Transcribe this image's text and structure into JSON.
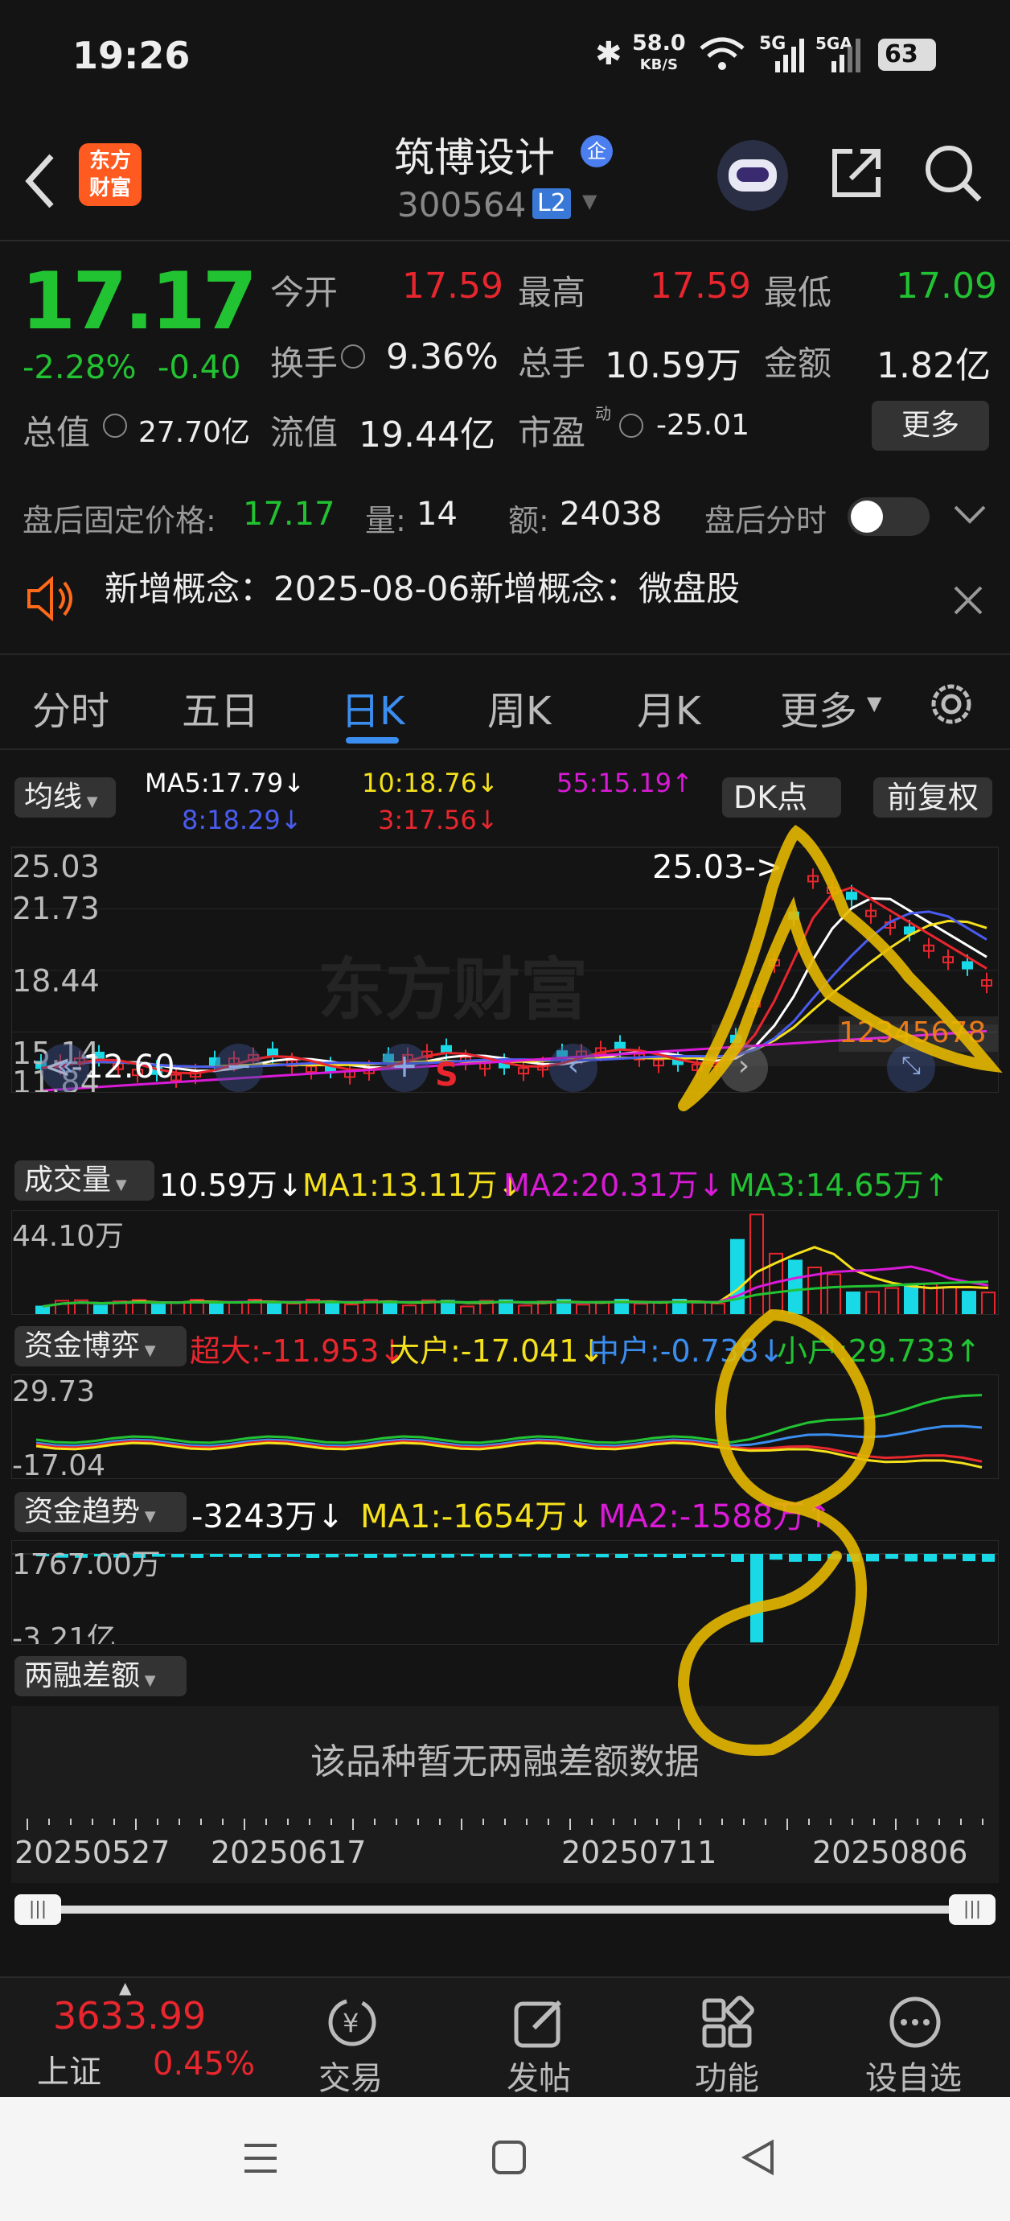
{
  "status": {
    "time": "19:26",
    "net_speed": "58.0",
    "net_unit": "KB/S",
    "sig1": "5G",
    "sig2": "5GA",
    "battery": "63"
  },
  "header": {
    "logo_line1": "东方",
    "logo_line2": "财富",
    "title": "筑博设计",
    "badge": "企",
    "code": "300564",
    "level": "L2"
  },
  "quote": {
    "price": "17.17",
    "change_pct": "-2.28%",
    "change": "-0.40",
    "open_label": "今开",
    "open": "17.59",
    "high_label": "最高",
    "high": "17.59",
    "low_label": "最低",
    "low": "17.09",
    "turnover_label": "换手",
    "turnover": "9.36%",
    "volume_label": "总手",
    "volume": "10.59万",
    "amount_label": "金额",
    "amount": "1.82亿",
    "mktcap_label": "总值",
    "mktcap": "27.70亿",
    "float_label": "流值",
    "float": "19.44亿",
    "pe_label": "市盈",
    "pe_sup": "动",
    "pe": "-25.01",
    "more": "更多",
    "after_label": "盘后固定价格:",
    "after_price": "17.17",
    "after_vol_label": "量:",
    "after_vol": "14",
    "after_amt_label": "额:",
    "after_amt": "24038",
    "after_toggle_label": "盘后分时",
    "notice": "新增概念：2025-08-06新增概念：微盘股"
  },
  "tabs": [
    "分时",
    "五日",
    "日K",
    "周K",
    "月K",
    "更多"
  ],
  "active_tab": 2,
  "kline": {
    "ma_button": "均线",
    "ma5": "MA5:17.79↓",
    "ma10": "10:18.76↓",
    "ma55": "55:15.19↑",
    "ma8": "8:18.29↓",
    "ma3": "3:17.56↓",
    "dk_button": "DK点",
    "fq_button": "前复权",
    "y_labels": [
      "25.03",
      "21.73",
      "18.44",
      "15.14",
      "11.84"
    ],
    "high_marker": "25.03->",
    "low_marker": "<-12.60",
    "signal": "S",
    "wm": "东方财富",
    "wave_labels": [
      "12",
      "34",
      "56",
      "78"
    ]
  },
  "volume": {
    "button": "成交量",
    "v": "10.59万↓",
    "ma1": "MA1:13.11万↓",
    "ma2": "MA2:20.31万↓",
    "ma3": "MA3:14.65万↑",
    "y_label": "44.10万"
  },
  "fund_game": {
    "button": "资金博弈",
    "super": "超大:-11.953↓",
    "large": "大户:-17.041↓",
    "mid": "中户:-0.738↓",
    "small": "小户:29.733↑",
    "y_top": "29.73",
    "y_bottom": "-17.04"
  },
  "fund_trend": {
    "button": "资金趋势",
    "v": "-3243万↓",
    "ma1": "MA1:-1654万↓",
    "ma2": "MA2:-1588万↑",
    "y_top": "1767.00万",
    "y_bottom": "-3.21亿"
  },
  "margin": {
    "button": "两融差额",
    "empty": "该品种暂无两融差额数据"
  },
  "dates": [
    "20250527",
    "20250617",
    "20250711",
    "20250806"
  ],
  "bottom": {
    "index_value": "3633.99",
    "index_name": "上证",
    "index_change": "0.45%",
    "items": [
      "交易",
      "发帖",
      "功能",
      "设自选"
    ]
  },
  "colors": {
    "up": "#e8262e",
    "down": "#22c332",
    "accent": "#3b8ef0",
    "bg": "#141414"
  },
  "chart_data": [
    {
      "type": "candlestick",
      "title": "日K",
      "ylim": [
        11.84,
        25.03
      ],
      "x": [
        "20250527",
        "20250617",
        "20250711",
        "20250806"
      ],
      "series": [
        {
          "name": "MA5",
          "last": 17.79
        },
        {
          "name": "MA10",
          "last": 18.76
        },
        {
          "name": "MA55",
          "last": 15.19
        },
        {
          "name": "MA8",
          "last": 18.29
        },
        {
          "name": "MA3",
          "last": 17.56
        }
      ],
      "annotations": [
        "25.03->",
        "<-12.60",
        "S"
      ]
    },
    {
      "type": "bar",
      "title": "成交量",
      "ylim": [
        0,
        44.1
      ],
      "unit": "万",
      "latest": 10.59,
      "series": [
        {
          "name": "MA1",
          "last": 13.11
        },
        {
          "name": "MA2",
          "last": 20.31
        },
        {
          "name": "MA3",
          "last": 14.65
        }
      ]
    },
    {
      "type": "line",
      "title": "资金博弈",
      "ylim": [
        -17.04,
        29.73
      ],
      "series": [
        {
          "name": "超大",
          "last": -11.953
        },
        {
          "name": "大户",
          "last": -17.041
        },
        {
          "name": "中户",
          "last": -0.738
        },
        {
          "name": "小户",
          "last": 29.733
        }
      ]
    },
    {
      "type": "bar",
      "title": "资金趋势",
      "unit": "万",
      "latest": -3243,
      "series": [
        {
          "name": "MA1",
          "last": -1654
        },
        {
          "name": "MA2",
          "last": -1588
        }
      ]
    }
  ]
}
